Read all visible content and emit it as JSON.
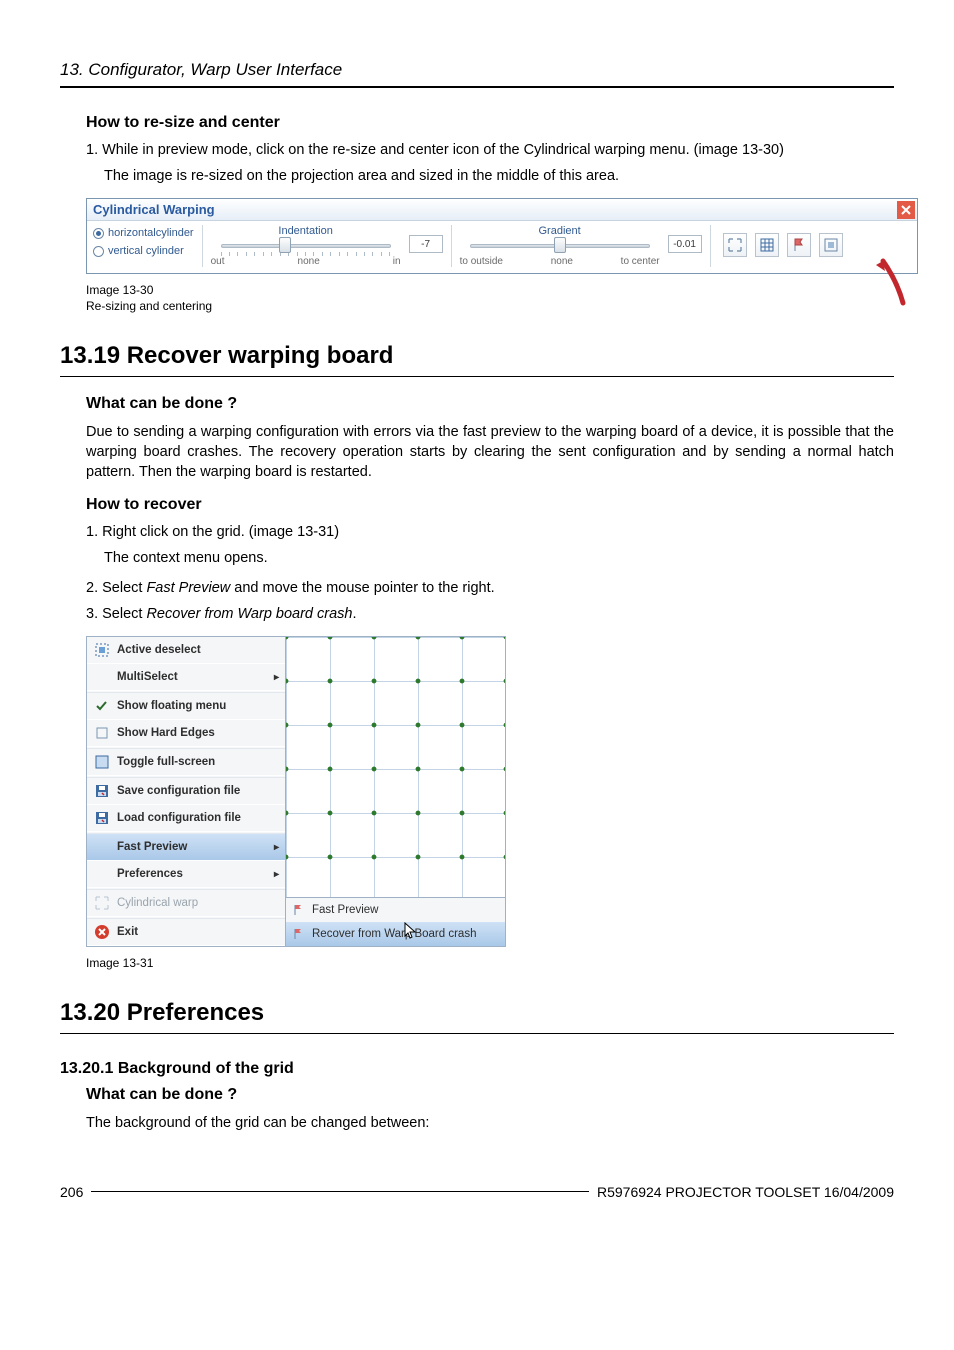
{
  "header": {
    "running": "13. Configurator, Warp User Interface"
  },
  "sec_resize": {
    "title": "How to re-size and center",
    "step1": "1. While in preview mode, click on the re-size and center icon of the Cylindrical warping menu.  (image 13-30)",
    "step1_note": "The image is re-sized on the projection area and sized in the middle of this area."
  },
  "img1330": {
    "window_title": "Cylindrical Warping",
    "radio1": "horizontalcylinder",
    "radio2": "vertical cylinder",
    "indent_label": "Indentation",
    "indent_out": "out",
    "indent_none": "none",
    "indent_in": "in",
    "indent_value": "-7",
    "grad_label": "Gradient",
    "grad_out": "to outside",
    "grad_none": "none",
    "grad_center": "to center",
    "grad_value": "-0.01",
    "caption_a": "Image 13-30",
    "caption_b": "Re-sizing and centering"
  },
  "sec_recover": {
    "h1": "13.19 Recover warping board",
    "what_title": "What can be done ?",
    "what_para": "Due to sending a warping configuration with errors via the fast preview to the warping board of a device, it is possible that the warping board crashes. The recovery operation starts by clearing the sent configuration and by sending a normal hatch pattern. Then the warping board is restarted.",
    "how_title": "How to recover",
    "step1": "1. Right click on the grid. (image 13-31)",
    "step1_note": "The context menu opens.",
    "step2": "2. Select Fast Preview and move the mouse pointer to the right.",
    "step2_em": "Fast Preview",
    "step3": "3. Select Recover from Warp board crash.",
    "step3_em": "Recover from Warp board crash"
  },
  "img1331": {
    "items": {
      "active_deselect": "Active deselect",
      "multiselect": "MultiSelect",
      "show_floating": "Show floating menu",
      "show_hard": "Show Hard Edges",
      "toggle_full": "Toggle full-screen",
      "save_conf": "Save configuration file",
      "load_conf": "Load configuration file",
      "fast_preview": "Fast Preview",
      "preferences": "Preferences",
      "cyl_warp": "Cylindrical warp",
      "exit": "Exit"
    },
    "sub": {
      "fast_preview": "Fast Preview",
      "recover": "Recover from Warp Board crash"
    },
    "caption": "Image 13-31"
  },
  "sec_prefs": {
    "h1": "13.20 Preferences",
    "h2": "13.20.1 Background of the grid",
    "what_title": "What can be done ?",
    "what_para": "The background of the grid can be changed between:"
  },
  "footer": {
    "page": "206",
    "right": "R5976924   PROJECTOR TOOLSET  16/04/2009"
  }
}
